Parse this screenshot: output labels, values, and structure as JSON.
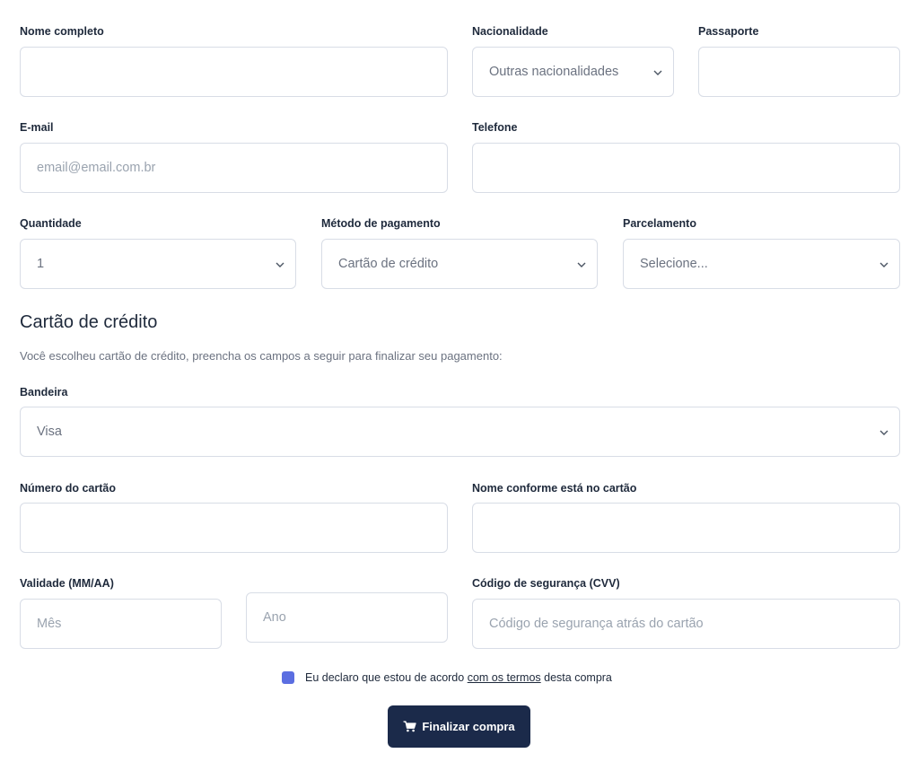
{
  "colors": {
    "border": "#d8dde6",
    "label": "#1e293b",
    "placeholder": "#9aa3af",
    "button_bg": "#1b2a4a",
    "checkbox": "#5b6ee1"
  },
  "form": {
    "nome_completo": {
      "label": "Nome completo",
      "value": ""
    },
    "nacionalidade": {
      "label": "Nacionalidade",
      "selected": "Outras nacionalidades"
    },
    "passaporte": {
      "label": "Passaporte",
      "value": ""
    },
    "email": {
      "label": "E-mail",
      "placeholder": "email@email.com.br"
    },
    "telefone": {
      "label": "Telefone",
      "value": ""
    },
    "quantidade": {
      "label": "Quantidade",
      "selected": "1"
    },
    "metodo_pagamento": {
      "label": "Método de pagamento",
      "selected": "Cartão de crédito"
    },
    "parcelamento": {
      "label": "Parcelamento",
      "selected": "Selecione..."
    }
  },
  "credit_card": {
    "title": "Cartão de crédito",
    "description": "Você escolheu cartão de crédito, preencha os campos a seguir para finalizar seu pagamento:",
    "bandeira": {
      "label": "Bandeira",
      "selected": "Visa"
    },
    "numero": {
      "label": "Número do cartão",
      "value": ""
    },
    "nome_cartao": {
      "label": "Nome conforme está no cartão",
      "value": ""
    },
    "validade": {
      "label": "Validade (MM/AA)",
      "mes_placeholder": "Mês",
      "ano_placeholder": "Ano"
    },
    "cvv": {
      "label": "Código de segurança (CVV)",
      "placeholder": "Código de segurança atrás do cartão"
    }
  },
  "terms": {
    "before": "Eu declaro que estou de acordo",
    "link": "com os termos",
    "after": "desta compra",
    "checked": true
  },
  "submit": {
    "label": "Finalizar compra",
    "icon": "cart-icon"
  }
}
